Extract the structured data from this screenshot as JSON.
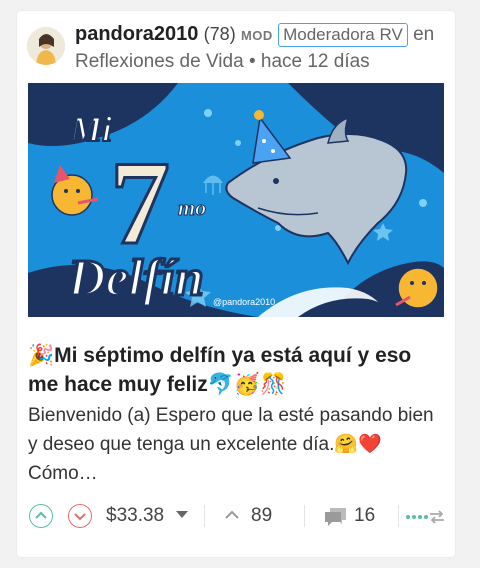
{
  "post": {
    "author": "pandora2010",
    "reputation": "(78)",
    "mod_badge": "MOD",
    "role": "Moderadora RV",
    "community_prefix": "en",
    "community": "Reflexiones de Vida",
    "separator": "•",
    "time": "hace 12 días",
    "image": {
      "line1": "Mi",
      "line2": "7",
      "line2_suffix": "mo",
      "line3": "Delfín",
      "watermark": "@pandora2010"
    },
    "title": "🎉Mi séptimo delfín ya está aquí y eso me hace muy feliz🐬🥳🎊",
    "body": "Bienvenido (a) Espero que la esté pasando bien y deseo que tenga un excelente día.🤗❤️ Cómo…",
    "payout": "$33.38",
    "votes": "89",
    "comments": "16"
  },
  "colors": {
    "accent": "#4ba2f2",
    "upvote": "#57c09a",
    "downvote": "#e26d6d",
    "banner_blue": "#1b8fd9",
    "banner_navy": "#1d3461"
  },
  "icons": [
    "upvote-icon",
    "downvote-icon",
    "dropdown-caret-icon",
    "vote-chevron-icon",
    "comments-icon",
    "reblog-icon"
  ]
}
